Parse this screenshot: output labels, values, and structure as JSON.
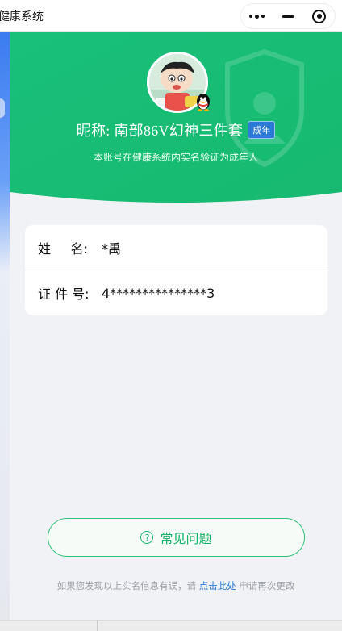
{
  "window": {
    "title": "健康系统"
  },
  "capsule": {
    "more_icon": "more-dots-icon",
    "minimize_icon": "minimize-icon",
    "close_icon": "target-circle-icon"
  },
  "colors": {
    "primary_green": "#16b36a",
    "header_green": "#1bc477",
    "badge_blue": "#2b7bd6",
    "link_blue": "#2b7bd6",
    "page_bg": "#f1f2f6"
  },
  "profile": {
    "nickname": "昵称: 南部86V幻神三件套",
    "age_badge": "成年",
    "subtitle": "本账号在健康系统内实名验证为成年人",
    "avatar_icon": "cartoon-avatar",
    "platform_icon": "qq-penguin-icon"
  },
  "identity": {
    "name_label": [
      "姓",
      "名:"
    ],
    "name_value": "*禹",
    "id_label": "证 件 号:",
    "id_value": "4***************3"
  },
  "faq": {
    "label": "常见问题",
    "icon": "question-circle-icon"
  },
  "footer": {
    "prefix": "如果您发现以上实名信息有误，请 ",
    "link": "点击此处",
    "suffix": " 申请再次更改"
  }
}
